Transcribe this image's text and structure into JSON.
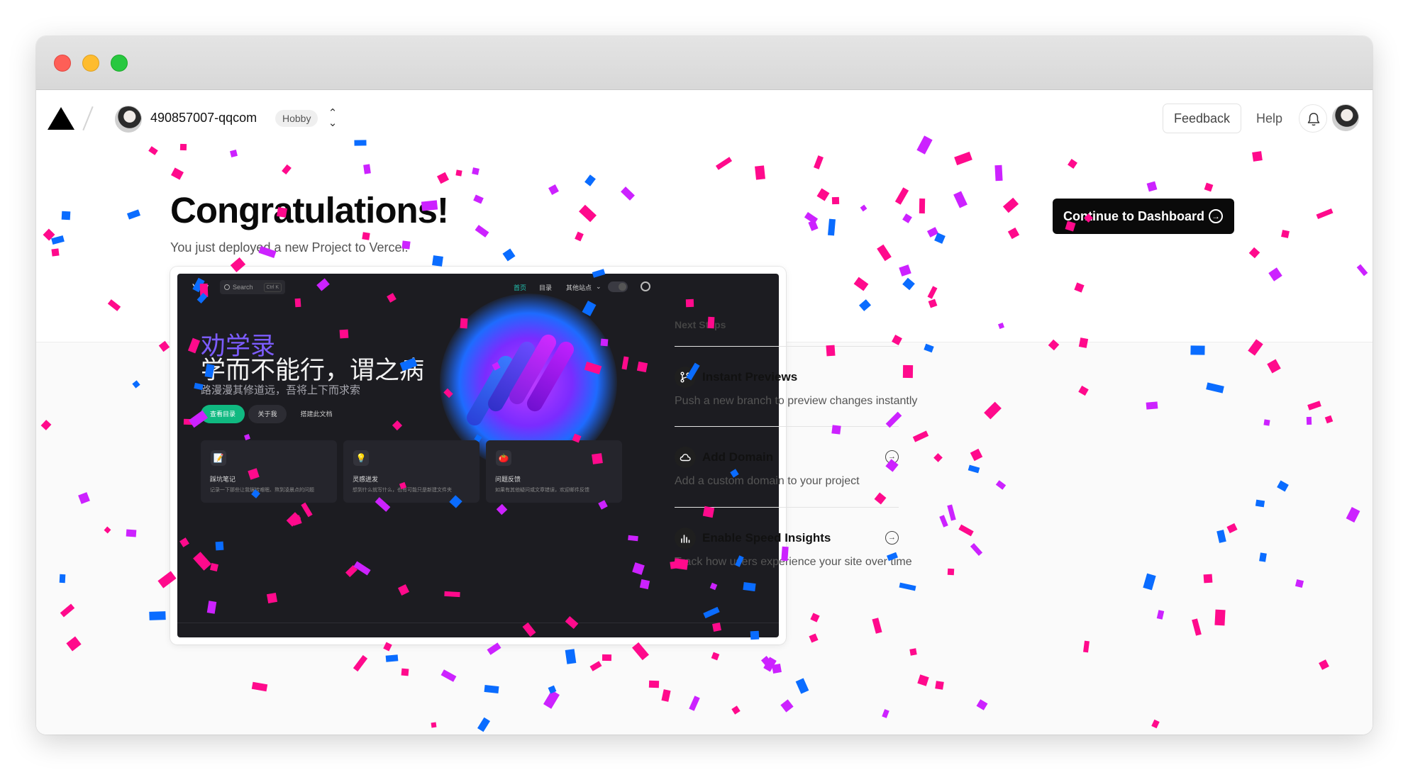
{
  "window": {
    "traffic_lights": [
      "close",
      "minimize",
      "zoom"
    ]
  },
  "nav": {
    "account_name": "490857007-qqcom",
    "plan_badge": "Hobby",
    "switcher_icon": "chevron-up-down-icon",
    "feedback_label": "Feedback",
    "help_label": "Help",
    "bell_icon": "bell-icon"
  },
  "hero": {
    "title": "Congratulations!",
    "subtitle": "You just deployed a new Project to Vercel.",
    "continue_label": "Continue to Dashboard"
  },
  "preview": {
    "brand": "Yiov",
    "search_placeholder": "Search",
    "search_shortcut": "Ctrl K",
    "nav_items": [
      "首页",
      "目录",
      "其他站点"
    ],
    "heading_accent": "劝学录",
    "heading_main": "学而不能行，谓之病",
    "tagline": "路漫漫其修道远，吾将上下而求索",
    "buttons": [
      "查看目录",
      "关于我",
      "搭建此文档"
    ],
    "cards": [
      {
        "icon": "📝",
        "title": "踩坑笔记",
        "desc": "记录一下那些让我辗转难眠、熬到凌晨点的问题"
      },
      {
        "icon": "💡",
        "title": "灵感迸发",
        "desc": "想到什么就写什么，也有可能只是新建文件夹"
      },
      {
        "icon": "🍅",
        "title": "问题反馈",
        "desc": "如果有其他疑问或文章错误，欢迎邮件反馈"
      }
    ]
  },
  "next_steps": {
    "title": "Next Steps",
    "items": [
      {
        "icon": "branch-icon",
        "title": "Instant Previews",
        "desc": "Push a new branch to preview changes instantly",
        "has_link": false
      },
      {
        "icon": "cloud-icon",
        "title": "Add Domain",
        "desc": "Add a custom domain to your project",
        "has_link": true
      },
      {
        "icon": "chart-icon",
        "title": "Enable Speed Insights",
        "desc": "Track how users experience your site over time",
        "has_link": true
      }
    ]
  },
  "colors": {
    "confetti_pink": "#ff0a8c",
    "confetti_purple": "#cc22ff",
    "confetti_blue": "#0a6cff",
    "accent_green": "#10b981",
    "accent_violet": "#7c5cff"
  }
}
